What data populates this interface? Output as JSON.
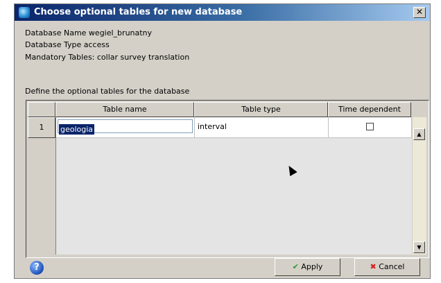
{
  "window": {
    "title": "Choose optional tables for new database",
    "close_symbol": "✕"
  },
  "info": {
    "database_name": "Database Name  wegiel_brunatny",
    "database_type": " Database Type  access",
    "mandatory_tables": "Mandatory Tables: collar  survey  translation",
    "define_label": "Define the optional tables for the database"
  },
  "table": {
    "columns": [
      "Table name",
      "Table type",
      "Time dependent"
    ],
    "rows": [
      {
        "index": "1",
        "name": "geologia",
        "type": "interval",
        "time_dependent": false
      }
    ]
  },
  "buttons": {
    "apply": "Apply",
    "cancel": "Cancel",
    "help": "?"
  },
  "scrollbar": {
    "up": "▲",
    "down": "▼"
  },
  "colors": {
    "title_start": "#0a246a",
    "title_end": "#a6caf0",
    "dialog_bg": "#d4d0c8",
    "selection": "#0a246a"
  }
}
